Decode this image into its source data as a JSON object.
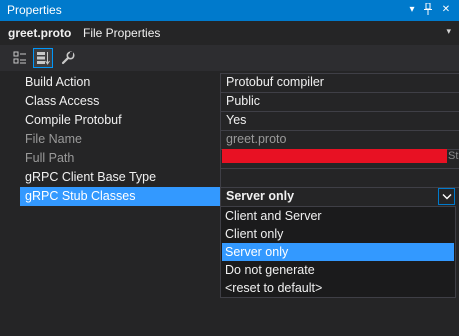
{
  "window": {
    "title": "Properties",
    "buttons": {
      "dropdown_glyph": "▾",
      "pin_glyph": "⊥",
      "close_glyph": "✕"
    }
  },
  "object_selector": {
    "name": "greet.proto",
    "type": "File Properties",
    "arrow_glyph": "▾"
  },
  "toolbar": {
    "buttons": [
      {
        "icon": "categorized-icon",
        "active": false
      },
      {
        "icon": "alphabetical-icon",
        "active": true
      },
      {
        "icon": "property-pages-wrench-icon",
        "active": false
      }
    ]
  },
  "properties": [
    {
      "name": "Build Action",
      "value": "Protobuf compiler",
      "readonly": false
    },
    {
      "name": "Class Access",
      "value": "Public",
      "readonly": false
    },
    {
      "name": "Compile Protobuf",
      "value": "Yes",
      "readonly": false
    },
    {
      "name": "File Name",
      "value": "greet.proto",
      "readonly": true
    },
    {
      "name": "Full Path",
      "value": "",
      "readonly": true,
      "redacted": true,
      "trailing_text": "St"
    },
    {
      "name": "gRPC Client Base Type",
      "value": "",
      "readonly": false
    },
    {
      "name": "gRPC Stub Classes",
      "value": "Server only",
      "readonly": false,
      "selected": true
    }
  ],
  "dropdown": {
    "options": [
      "Client and Server",
      "Client only",
      "Server only",
      "Do not generate",
      "<reset to default>"
    ],
    "selected_index": 2
  },
  "colors": {
    "accent": "#007acc",
    "selection": "#3399ff",
    "background": "#252526",
    "redaction": "#e81123"
  }
}
